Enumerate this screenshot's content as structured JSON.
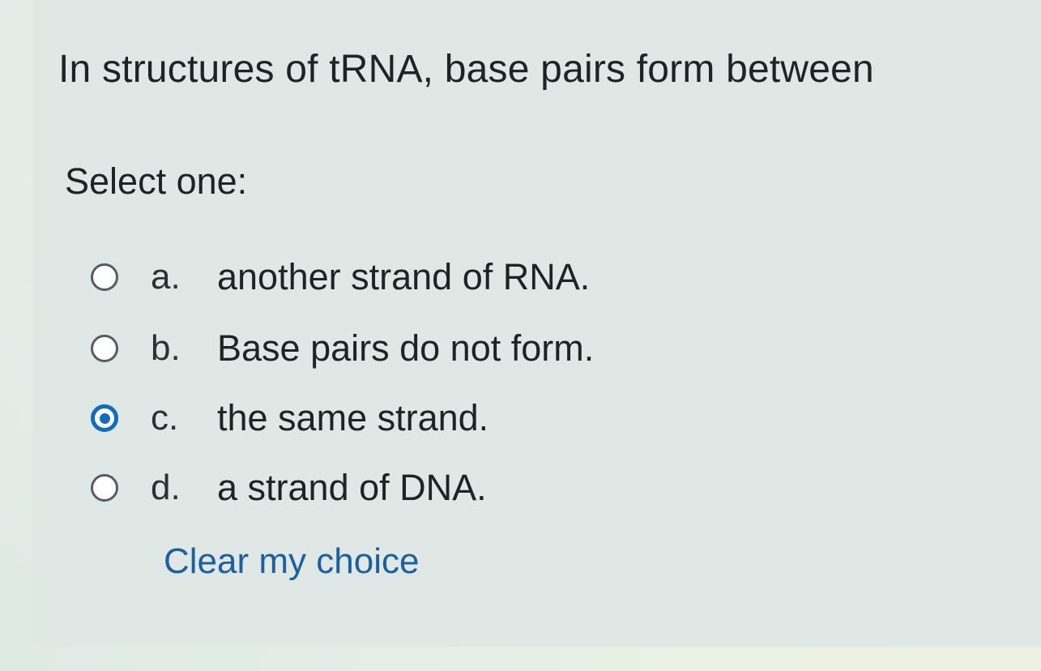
{
  "question": {
    "text": "In structures of tRNA, base pairs form between",
    "prompt": "Select one:"
  },
  "options": [
    {
      "letter": "a.",
      "text": "another strand of RNA.",
      "selected": false
    },
    {
      "letter": "b.",
      "text": "Base pairs do not form.",
      "selected": false
    },
    {
      "letter": "c.",
      "text": "the same strand.",
      "selected": true
    },
    {
      "letter": "d.",
      "text": "a strand of DNA.",
      "selected": false
    }
  ],
  "clear_choice_label": "Clear my choice",
  "colors": {
    "accent": "#0f6cbf",
    "link": "#1d5fa0",
    "panel_background": "#dfe8e5"
  }
}
